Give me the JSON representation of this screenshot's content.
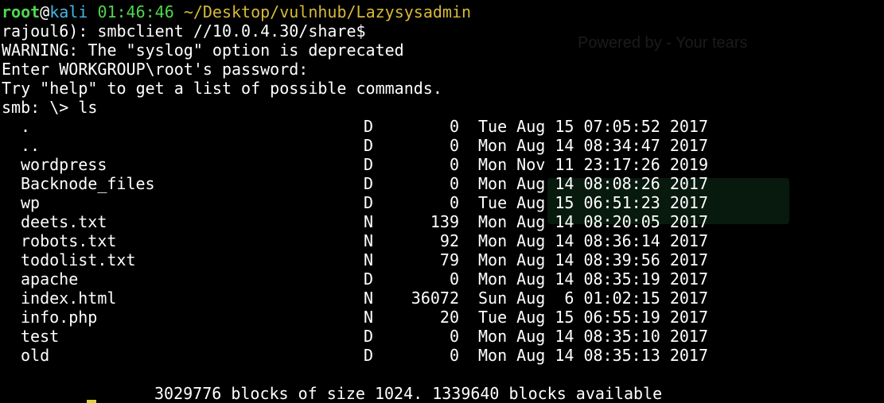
{
  "prompt": {
    "user": "root",
    "at": "@",
    "host": "kali",
    "time": "01:46:46",
    "path": "~/Desktop/vulnhub/Lazysysadmin"
  },
  "lines": {
    "command": "rajoul6): smbclient //10.0.4.30/share$",
    "warning": "WARNING: The \"syslog\" option is deprecated",
    "password_prompt": "Enter WORKGROUP\\root's password:",
    "help_hint": "Try \"help\" to get a list of possible commands.",
    "smb_prompt": "smb: \\> ls"
  },
  "listing": [
    {
      "name": ".",
      "type": "D",
      "size": "0",
      "date": "Tue Aug 15 07:05:52 2017"
    },
    {
      "name": "..",
      "type": "D",
      "size": "0",
      "date": "Mon Aug 14 08:34:47 2017"
    },
    {
      "name": "wordpress",
      "type": "D",
      "size": "0",
      "date": "Mon Nov 11 23:17:26 2019"
    },
    {
      "name": "Backnode_files",
      "type": "D",
      "size": "0",
      "date": "Mon Aug 14 08:08:26 2017"
    },
    {
      "name": "wp",
      "type": "D",
      "size": "0",
      "date": "Tue Aug 15 06:51:23 2017"
    },
    {
      "name": "deets.txt",
      "type": "N",
      "size": "139",
      "date": "Mon Aug 14 08:20:05 2017"
    },
    {
      "name": "robots.txt",
      "type": "N",
      "size": "92",
      "date": "Mon Aug 14 08:36:14 2017"
    },
    {
      "name": "todolist.txt",
      "type": "N",
      "size": "79",
      "date": "Mon Aug 14 08:39:56 2017"
    },
    {
      "name": "apache",
      "type": "D",
      "size": "0",
      "date": "Mon Aug 14 08:35:19 2017"
    },
    {
      "name": "index.html",
      "type": "N",
      "size": "36072",
      "date": "Sun Aug  6 01:02:15 2017"
    },
    {
      "name": "info.php",
      "type": "N",
      "size": "20",
      "date": "Tue Aug 15 06:55:19 2017"
    },
    {
      "name": "test",
      "type": "D",
      "size": "0",
      "date": "Mon Aug 14 08:35:10 2017"
    },
    {
      "name": "old",
      "type": "D",
      "size": "0",
      "date": "Mon Aug 14 08:35:13 2017"
    }
  ],
  "summary": "3029776 blocks of size 1024. 1339640 blocks available",
  "wallpaper": {
    "text": "Powered by - Your tears"
  },
  "colors": {
    "background": "#000000",
    "user": "#4fd64f",
    "host": "#45b8e6",
    "path": "#d7b93a",
    "text": "#ffffff"
  }
}
